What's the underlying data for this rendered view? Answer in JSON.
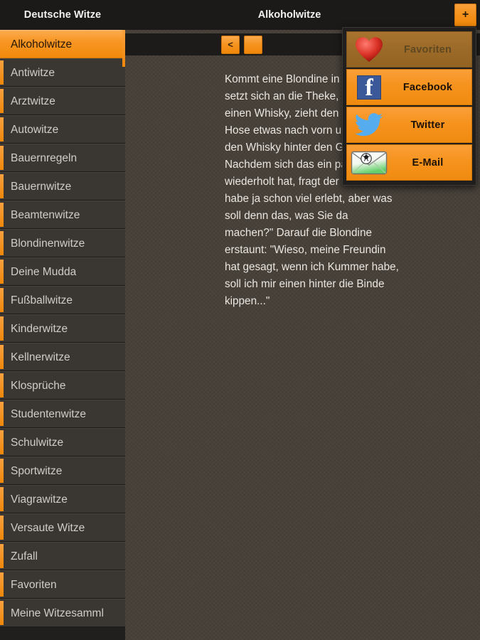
{
  "topbar": {
    "left_title": "Deutsche Witze",
    "main_title": "Alkoholwitze",
    "add_label": "+"
  },
  "sidebar": {
    "items": [
      {
        "label": "Alkoholwitze",
        "selected": true
      },
      {
        "label": "Antiwitze",
        "selected": false
      },
      {
        "label": "Arztwitze",
        "selected": false
      },
      {
        "label": "Autowitze",
        "selected": false
      },
      {
        "label": "Bauernregeln",
        "selected": false
      },
      {
        "label": "Bauernwitze",
        "selected": false
      },
      {
        "label": "Beamtenwitze",
        "selected": false
      },
      {
        "label": "Blondinenwitze",
        "selected": false
      },
      {
        "label": "Deine Mudda",
        "selected": false
      },
      {
        "label": "Fußballwitze",
        "selected": false
      },
      {
        "label": "Kinderwitze",
        "selected": false
      },
      {
        "label": "Kellnerwitze",
        "selected": false
      },
      {
        "label": "Klosprüche",
        "selected": false
      },
      {
        "label": "Studentenwitze",
        "selected": false
      },
      {
        "label": "Schulwitze",
        "selected": false
      },
      {
        "label": "Sportwitze",
        "selected": false
      },
      {
        "label": "Viagrawitze",
        "selected": false
      },
      {
        "label": "Versaute Witze",
        "selected": false
      },
      {
        "label": "Zufall",
        "selected": false
      },
      {
        "label": "Favoriten",
        "selected": false
      },
      {
        "label": "Meine Witzesamml",
        "selected": false
      }
    ]
  },
  "content": {
    "pager": {
      "prev_label": "<",
      "page_label": ""
    },
    "joke_text": "Kommt eine Blondine in die Kneipe, setzt sich an die Theke, bestellt einen Whisky, zieht den Gürtel ihrer Hose etwas nach vorn und kippt den Whisky hinter den Gürtel. Nachdem sich das ein paar mal wiederholt hat, fragt der Wirt: \"Ich habe ja schon viel erlebt, aber was soll denn das, was Sie da machen?\" Darauf die Blondine erstaunt: \"Wieso, meine Freundin hat gesagt, wenn ich Kummer habe, soll ich mir einen hinter die Binde kippen...\""
  },
  "share_popup": {
    "items": [
      {
        "label": "Favoriten",
        "icon": "heart-icon",
        "disabled": true
      },
      {
        "label": "Facebook",
        "icon": "facebook-icon",
        "disabled": false
      },
      {
        "label": "Twitter",
        "icon": "twitter-icon",
        "disabled": false
      },
      {
        "label": "E-Mail",
        "icon": "envelope-icon",
        "disabled": false
      }
    ]
  },
  "colors": {
    "accent_orange": "#f6931e",
    "accent_orange_light": "#fbab4d",
    "sidebar_row": "#3a3632",
    "content_bg": "#463f38",
    "topbar_bg": "#1b1a18",
    "facebook_blue": "#3b5998",
    "twitter_blue": "#55acee",
    "heart_red": "#d93025"
  }
}
